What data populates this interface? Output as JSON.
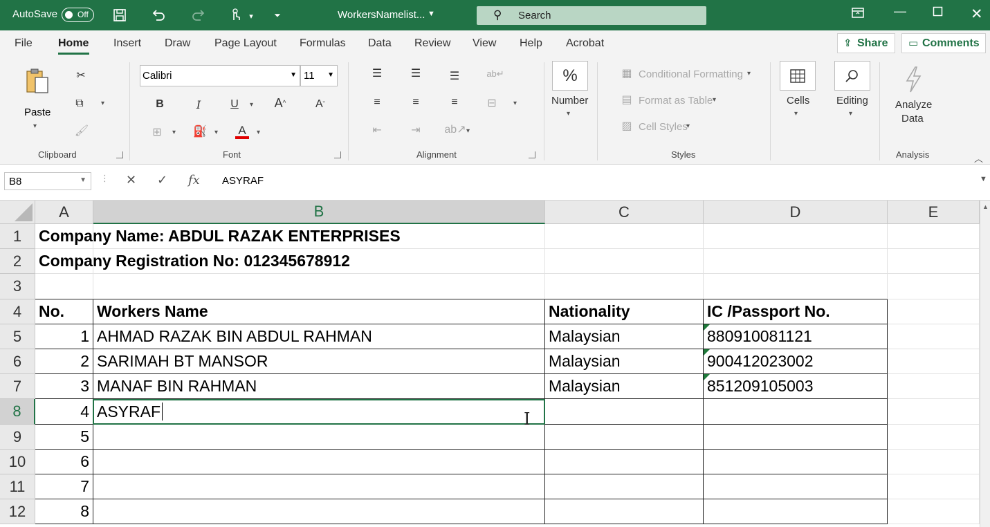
{
  "titlebar": {
    "autosave_label": "AutoSave",
    "autosave_state": "Off",
    "doc_title": "WorkersNamelist...",
    "search_placeholder": "Search",
    "accent": "#217346"
  },
  "ribbon_tabs": [
    "File",
    "Home",
    "Insert",
    "Draw",
    "Page Layout",
    "Formulas",
    "Data",
    "Review",
    "View",
    "Help",
    "Acrobat"
  ],
  "active_tab": "Home",
  "share_label": "Share",
  "comments_label": "Comments",
  "groups": {
    "clipboard": {
      "label": "Clipboard",
      "paste": "Paste"
    },
    "font": {
      "label": "Font",
      "font_name": "Calibri",
      "font_size": "11"
    },
    "alignment": {
      "label": "Alignment"
    },
    "number": {
      "label": "Number"
    },
    "styles": {
      "label": "Styles",
      "conditional": "Conditional Formatting",
      "format_table": "Format as Table",
      "cell_styles": "Cell Styles"
    },
    "cells": {
      "label": "Cells"
    },
    "editing": {
      "label": "Editing"
    },
    "analysis": {
      "label": "Analysis",
      "analyze_line1": "Analyze",
      "analyze_line2": "Data"
    }
  },
  "formula_bar": {
    "name_box": "B8",
    "value": "ASYRAF"
  },
  "columns": [
    "A",
    "B",
    "C",
    "D",
    "E"
  ],
  "selected_column": "B",
  "rows": [
    {
      "num": "1",
      "a": "Company Name: ABDUL RAZAK ENTERPRISES",
      "b": "",
      "c": "",
      "d": ""
    },
    {
      "num": "2",
      "a": "Company Registration No: 012345678912",
      "b": "",
      "c": "",
      "d": ""
    },
    {
      "num": "3",
      "a": "",
      "b": "",
      "c": "",
      "d": ""
    },
    {
      "num": "4",
      "a": "No.",
      "b": "Workers Name",
      "c": "Nationality",
      "d": "IC /Passport No."
    },
    {
      "num": "5",
      "a": "1",
      "b": "AHMAD RAZAK BIN ABDUL RAHMAN",
      "c": "Malaysian",
      "d": "880910081121"
    },
    {
      "num": "6",
      "a": "2",
      "b": "SARIMAH BT MANSOR",
      "c": "Malaysian",
      "d": "900412023002"
    },
    {
      "num": "7",
      "a": "3",
      "b": "MANAF BIN RAHMAN",
      "c": "Malaysian",
      "d": "851209105003"
    },
    {
      "num": "8",
      "a": "4",
      "b": "ASYRAF",
      "c": "",
      "d": ""
    },
    {
      "num": "9",
      "a": "5",
      "b": "",
      "c": "",
      "d": ""
    },
    {
      "num": "10",
      "a": "6",
      "b": "",
      "c": "",
      "d": ""
    },
    {
      "num": "11",
      "a": "7",
      "b": "",
      "c": "",
      "d": ""
    },
    {
      "num": "12",
      "a": "8",
      "b": "",
      "c": "",
      "d": ""
    }
  ],
  "selected_row": "8"
}
